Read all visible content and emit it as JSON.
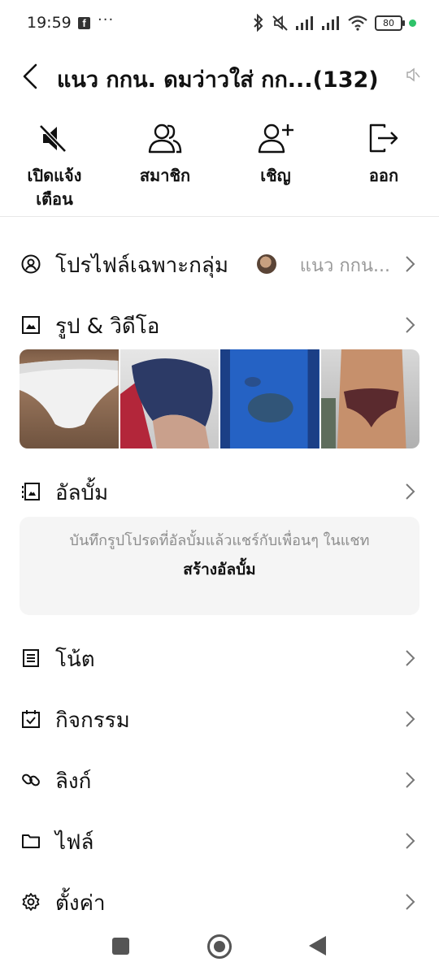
{
  "status_bar": {
    "time": "19:59",
    "battery": "80",
    "notification_icons": [
      "facebook-icon",
      "more-dots-icon"
    ],
    "system_icons": [
      "bluetooth-icon",
      "mute-icon",
      "signal-icon",
      "signal-icon",
      "wifi-icon",
      "battery-icon"
    ]
  },
  "header": {
    "title": "แนว กกน. ดมว่าวใส่ กก...(132)"
  },
  "actions": [
    {
      "label": "เปิดแจ้ง\nเตือน",
      "icon": "bell-off-icon"
    },
    {
      "label": "สมาชิก",
      "icon": "members-icon"
    },
    {
      "label": "เชิญ",
      "icon": "add-person-icon"
    },
    {
      "label": "ออก",
      "icon": "exit-icon"
    }
  ],
  "profile": {
    "label": "โปรไฟล์เฉพาะกลุ่ม",
    "value": "แนว กกน..."
  },
  "photos": {
    "label": "รูป & วิดีโอ"
  },
  "album": {
    "label": "อัลบั้ม",
    "hint": "บันทึกรูปโปรดที่อัลบั้มแล้วแชร์กับเพื่อนๆ ในแชท",
    "create": "สร้างอัลบั้ม"
  },
  "menu": {
    "notes": "โน้ต",
    "events": "กิจกรรม",
    "links": "ลิงก์",
    "files": "ไฟล์",
    "settings": "ตั้งค่า"
  },
  "colors": {
    "accent_green": "#2fc36a",
    "text": "#111111",
    "secondary_text": "#8d8d8d",
    "box_bg": "#f5f5f5"
  }
}
